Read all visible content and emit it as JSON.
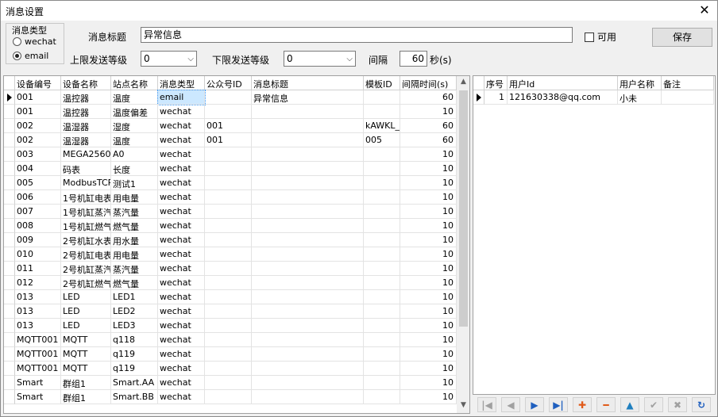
{
  "window": {
    "title": "消息设置",
    "close_glyph": "✕"
  },
  "message_type": {
    "group_label": "消息类型",
    "options": [
      {
        "label": "wechat",
        "selected": false
      },
      {
        "label": "email",
        "selected": true
      }
    ]
  },
  "form": {
    "title_label": "消息标题",
    "title_value": "异常信息",
    "enabled_label": "可用",
    "enabled_checked": false,
    "save_label": "保存",
    "upper_label": "上限发送等级",
    "upper_value": "0",
    "lower_label": "下限发送等级",
    "lower_value": "0",
    "interval_label": "间隔",
    "interval_value": "60",
    "interval_unit": "秒(s)"
  },
  "left_grid": {
    "columns": [
      "设备编号",
      "设备名称",
      "站点名称",
      "消息类型",
      "公众号ID",
      "消息标题",
      "模板ID",
      "间隔时间(s)"
    ],
    "rows": [
      [
        "001",
        "温控器",
        "温度",
        "email",
        "",
        "异常信息",
        "",
        "60"
      ],
      [
        "001",
        "温控器",
        "温度偏差",
        "wechat",
        "",
        "",
        "",
        "10"
      ],
      [
        "002",
        "温湿器",
        "湿度",
        "wechat",
        "001",
        "",
        "kAWKL_v",
        "60"
      ],
      [
        "002",
        "温湿器",
        "温度",
        "wechat",
        "001",
        "",
        "005",
        "60"
      ],
      [
        "003",
        "MEGA2560",
        "A0",
        "wechat",
        "",
        "",
        "",
        "10"
      ],
      [
        "004",
        "码表",
        "长度",
        "wechat",
        "",
        "",
        "",
        "10"
      ],
      [
        "005",
        "ModbusTCP",
        "测试1",
        "wechat",
        "",
        "",
        "",
        "10"
      ],
      [
        "006",
        "1号机缸电表",
        "用电量",
        "wechat",
        "",
        "",
        "",
        "10"
      ],
      [
        "007",
        "1号机缸蒸汽",
        "蒸汽量",
        "wechat",
        "",
        "",
        "",
        "10"
      ],
      [
        "008",
        "1号机缸燃气",
        "燃气量",
        "wechat",
        "",
        "",
        "",
        "10"
      ],
      [
        "009",
        "2号机缸水表",
        "用水量",
        "wechat",
        "",
        "",
        "",
        "10"
      ],
      [
        "010",
        "2号机缸电表",
        "用电量",
        "wechat",
        "",
        "",
        "",
        "10"
      ],
      [
        "011",
        "2号机缸蒸汽",
        "蒸汽量",
        "wechat",
        "",
        "",
        "",
        "10"
      ],
      [
        "012",
        "2号机缸燃气",
        "燃气量",
        "wechat",
        "",
        "",
        "",
        "10"
      ],
      [
        "013",
        "LED",
        "LED1",
        "wechat",
        "",
        "",
        "",
        "10"
      ],
      [
        "013",
        "LED",
        "LED2",
        "wechat",
        "",
        "",
        "",
        "10"
      ],
      [
        "013",
        "LED",
        "LED3",
        "wechat",
        "",
        "",
        "",
        "10"
      ],
      [
        "MQTT001",
        "MQTT",
        "q118",
        "wechat",
        "",
        "",
        "",
        "10"
      ],
      [
        "MQTT001",
        "MQTT",
        "q119",
        "wechat",
        "",
        "",
        "",
        "10"
      ],
      [
        "MQTT001",
        "MQTT",
        "q119",
        "wechat",
        "",
        "",
        "",
        "10"
      ],
      [
        "Smart",
        "群组1",
        "Smart.AA",
        "wechat",
        "",
        "",
        "",
        "10"
      ],
      [
        "Smart",
        "群组1",
        "Smart.BB",
        "wechat",
        "",
        "",
        "",
        "10"
      ]
    ],
    "current_row": 0
  },
  "right_grid": {
    "columns": [
      "序号",
      "用户Id",
      "用户名称",
      "备注"
    ],
    "rows": [
      [
        "1",
        "121630338@qq.com",
        "小未",
        ""
      ]
    ],
    "current_row": 0
  },
  "navigator": {
    "buttons": [
      {
        "name": "first",
        "glyph": "|◀",
        "color": "#a0a0a0"
      },
      {
        "name": "prior",
        "glyph": "◀",
        "color": "#a0a0a0"
      },
      {
        "name": "next",
        "glyph": "▶",
        "color": "#1f5fbf"
      },
      {
        "name": "last",
        "glyph": "▶|",
        "color": "#1f5fbf"
      },
      {
        "name": "insert",
        "glyph": "✚",
        "color": "#e05a1a"
      },
      {
        "name": "delete",
        "glyph": "━",
        "color": "#e05a1a"
      },
      {
        "name": "edit",
        "glyph": "▲",
        "color": "#1f7fbf"
      },
      {
        "name": "post",
        "glyph": "✔",
        "color": "#a0a0a0"
      },
      {
        "name": "cancel",
        "glyph": "✖",
        "color": "#a0a0a0"
      },
      {
        "name": "refresh",
        "glyph": "↻",
        "color": "#1f5fbf"
      }
    ]
  }
}
